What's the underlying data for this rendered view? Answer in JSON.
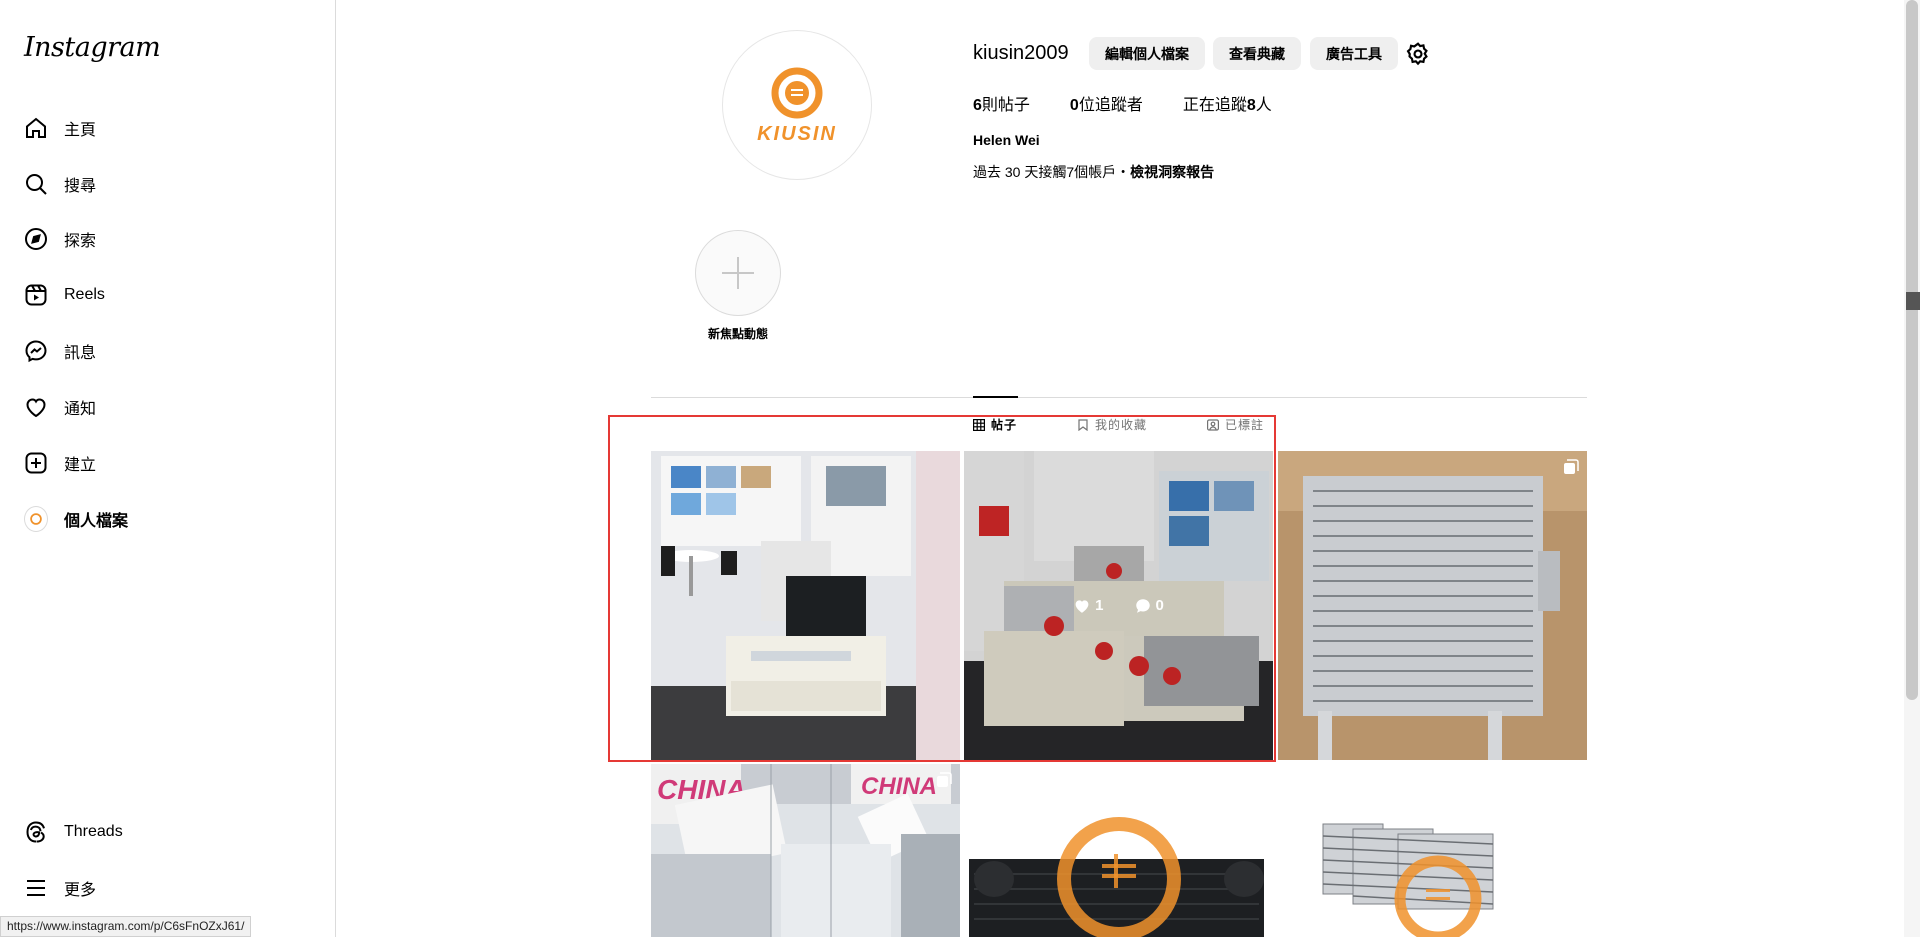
{
  "sidebar": {
    "logo": "Instagram",
    "items": [
      {
        "label": "主頁",
        "icon": "home-icon"
      },
      {
        "label": "搜尋",
        "icon": "search-icon"
      },
      {
        "label": "探索",
        "icon": "compass-icon"
      },
      {
        "label": "Reels",
        "icon": "reels-icon"
      },
      {
        "label": "訊息",
        "icon": "messenger-icon"
      },
      {
        "label": "通知",
        "icon": "heart-icon"
      },
      {
        "label": "建立",
        "icon": "plus-square-icon"
      },
      {
        "label": "個人檔案",
        "icon": "avatar"
      }
    ],
    "threads_label": "Threads",
    "more_label": "更多"
  },
  "status_url": "https://www.instagram.com/p/C6sFnOZxJ61/",
  "profile": {
    "avatar_text": "KIUSIN",
    "username": "kiusin2009",
    "edit_button": "編輯個人檔案",
    "archive_button": "查看典藏",
    "ad_tools_button": "廣告工具",
    "posts_count": "6",
    "posts_label": "則帖子",
    "followers_count": "0",
    "followers_label": "位追蹤者",
    "following_prefix": "正在追蹤",
    "following_count": "8",
    "following_suffix": "人",
    "full_name": "Helen Wei",
    "insights_text": "過去 30 天接觸7個帳戶・",
    "insights_link": "檢視洞察報告"
  },
  "highlight": {
    "label": "新焦點動態"
  },
  "tabs": [
    {
      "label": "帖子",
      "icon": "grid-icon",
      "active": true
    },
    {
      "label": "我的收藏",
      "icon": "bookmark-icon",
      "active": false
    },
    {
      "label": "已標註",
      "icon": "tagged-icon",
      "active": false
    }
  ],
  "posts": [
    {
      "likes": "1",
      "comments": "0"
    }
  ],
  "colors": {
    "brand_orange": "#f0922b",
    "highlight_box": "#e53935"
  }
}
